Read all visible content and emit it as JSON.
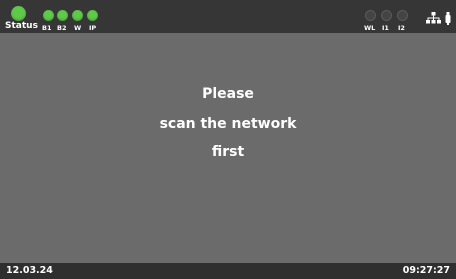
{
  "status_bar": {
    "status_label": "Status",
    "leds_left": [
      {
        "label": "B1",
        "state": "on"
      },
      {
        "label": "B2",
        "state": "on"
      },
      {
        "label": "W",
        "state": "on"
      },
      {
        "label": "IP",
        "state": "on"
      }
    ],
    "leds_right": [
      {
        "label": "WL",
        "state": "off"
      },
      {
        "label": "I1",
        "state": "off"
      },
      {
        "label": "I2",
        "state": "off"
      }
    ],
    "icons": [
      "network-icon",
      "usb-icon"
    ],
    "colors": {
      "led_on": "#5fc94a",
      "led_off": "#444444",
      "bar": "#363636"
    }
  },
  "main": {
    "message_lines": [
      "Please",
      "scan the network",
      "first"
    ]
  },
  "footer": {
    "date": "12.03.24",
    "time": "09:27:27"
  }
}
